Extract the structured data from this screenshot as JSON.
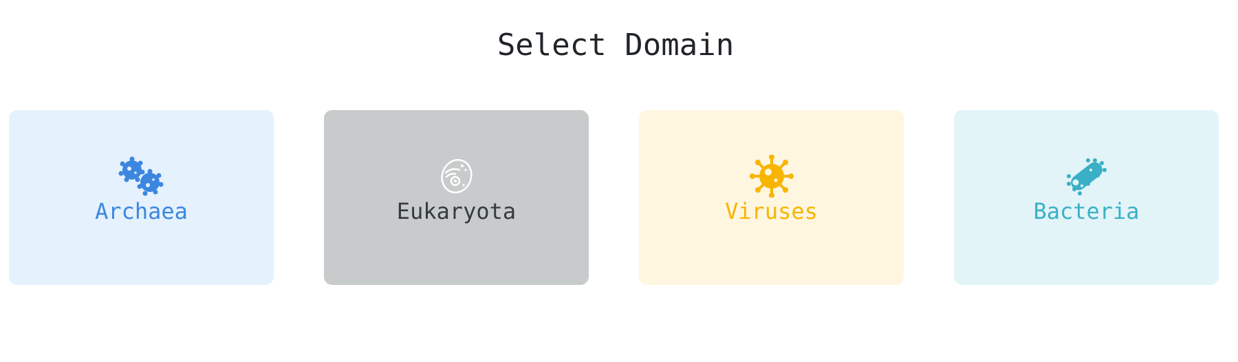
{
  "page": {
    "title": "Select Domain"
  },
  "domains": [
    {
      "label": "Archaea",
      "icon": "archaea-microbe-icon",
      "color": "#3b87e0",
      "background": "#e5f1fd"
    },
    {
      "label": "Eukaryota",
      "icon": "eukaryote-cell-icon",
      "color": "#343a40",
      "background": "#c8cbcb",
      "icon_color": "#ffffff"
    },
    {
      "label": "Viruses",
      "icon": "virus-icon",
      "color": "#f7b500",
      "background": "#fff6e0"
    },
    {
      "label": "Bacteria",
      "icon": "bacteria-icon",
      "color": "#3ab0c6",
      "background": "#e2f4f8"
    }
  ]
}
